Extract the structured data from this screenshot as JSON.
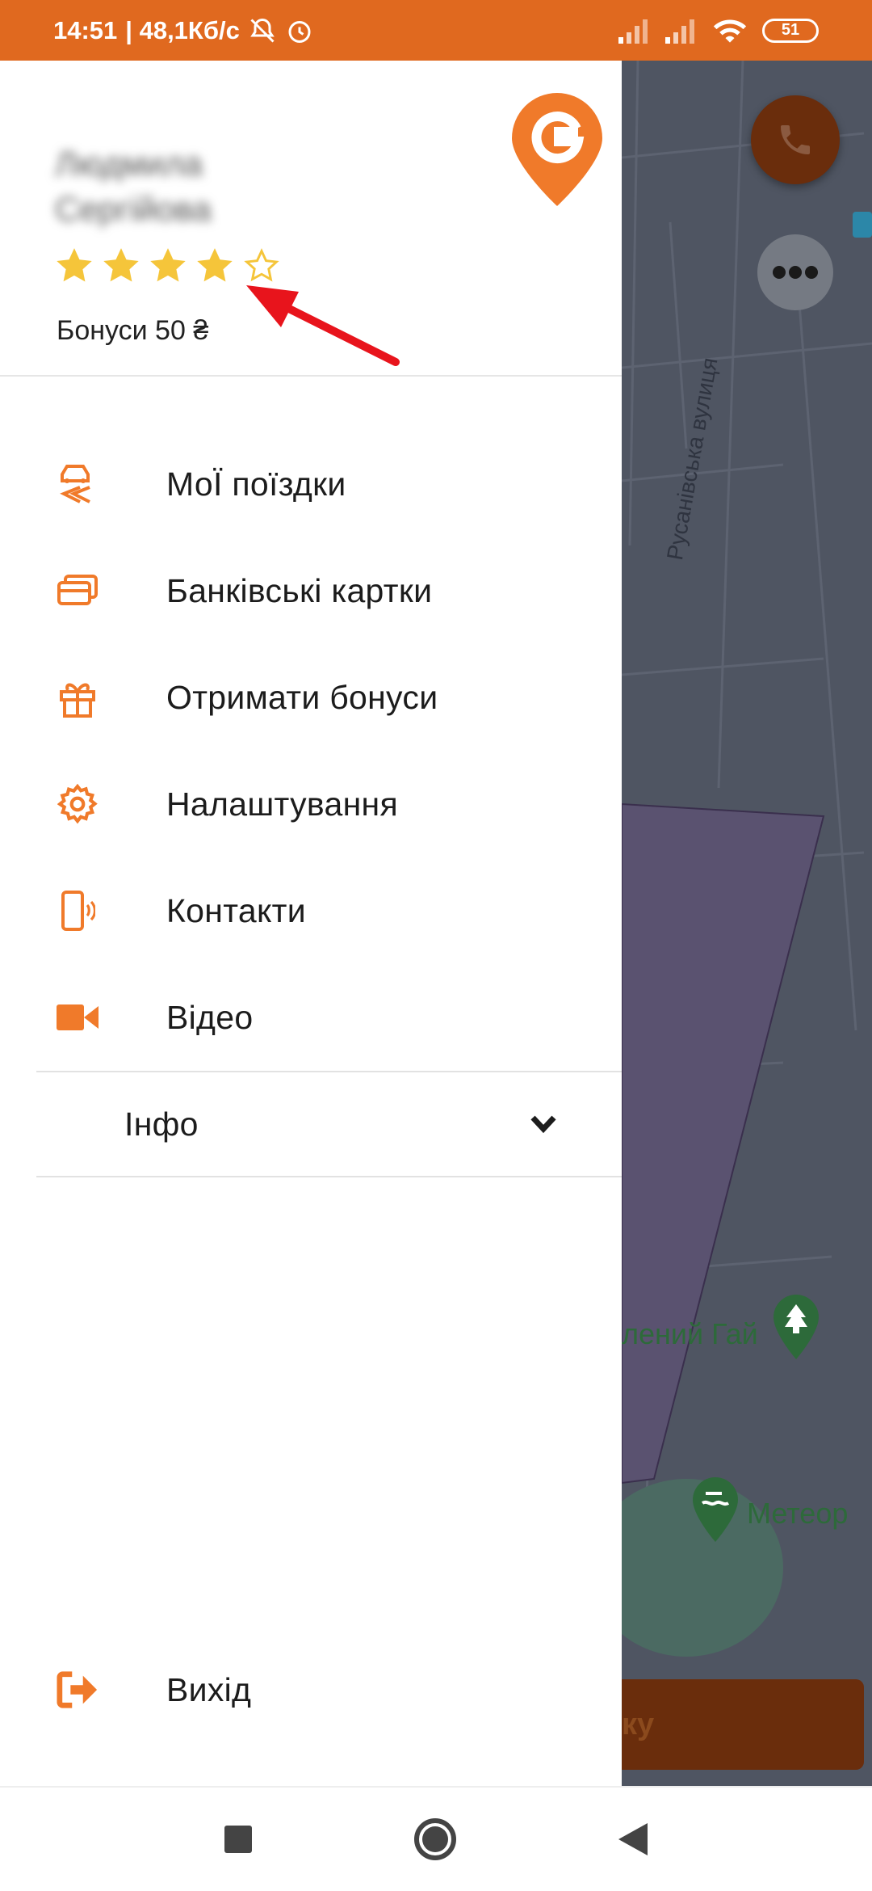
{
  "status_bar": {
    "time": "14:51",
    "speed": "| 48,1Кб/с",
    "battery": "51"
  },
  "drawer": {
    "user_name": "Людмила Сергійова",
    "rating": 4,
    "rating_max": 5,
    "bonus": "Бонуси 50 ₴",
    "menu": [
      {
        "label": "МоЇ поїздки",
        "icon": "trips-icon"
      },
      {
        "label": "Банківські картки",
        "icon": "cards-icon"
      },
      {
        "label": "Отримати бонуси",
        "icon": "gift-icon"
      },
      {
        "label": "Налаштування",
        "icon": "gear-icon"
      },
      {
        "label": "Контакти",
        "icon": "phone-contact-icon"
      },
      {
        "label": "Відео",
        "icon": "video-icon"
      }
    ],
    "info": "Інфо",
    "logout": "Вихід"
  },
  "map": {
    "street": "Русанівська вулиця",
    "place_1": "лений Гай",
    "place_2": "Метеор",
    "button_fragment": "ку"
  },
  "colors": {
    "accent": "#f07a2a",
    "status_bar": "#e0691f",
    "star": "#f5c53a",
    "arrow": "#e8141c"
  }
}
